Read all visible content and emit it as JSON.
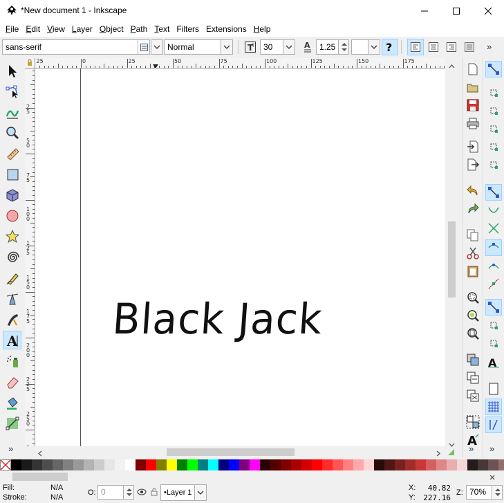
{
  "window": {
    "title": "*New document 1 - Inkscape"
  },
  "menu": [
    {
      "label": "File",
      "u": "F",
      "rest": "ile"
    },
    {
      "label": "Edit",
      "u": "E",
      "rest": "dit"
    },
    {
      "label": "View",
      "u": "V",
      "rest": "iew"
    },
    {
      "label": "Layer",
      "u": "L",
      "rest": "ayer"
    },
    {
      "label": "Object",
      "u": "O",
      "rest": "bject"
    },
    {
      "label": "Path",
      "u": "P",
      "rest": "ath"
    },
    {
      "label": "Text",
      "u": "T",
      "rest": "ext"
    },
    {
      "label": "Filters",
      "u": "",
      "rest": "Filters"
    },
    {
      "label": "Extensions",
      "u": "",
      "rest": "Extensions"
    },
    {
      "label": "Help",
      "u": "H",
      "rest": "elp"
    }
  ],
  "text_toolbar": {
    "font_family": "sans-serif",
    "font_style": "Normal",
    "font_size": "30",
    "line_spacing": "1.25",
    "overflow_label": "»"
  },
  "ruler_h": [
    "25",
    "0",
    "25",
    "50",
    "75",
    "100",
    "125",
    "150",
    "175"
  ],
  "ruler_v": [
    "2\n5",
    "5\n0",
    "7\n5",
    "1\n0\n0",
    "1\n2\n5",
    "1\n5\n0",
    "1\n7\n5",
    "2\n0\n0",
    "2\n2\n5",
    "2\n5\n0",
    "2\n7\n5"
  ],
  "canvas": {
    "text": "Black Jack"
  },
  "toolbox_overflow": "»",
  "commands_overflow": "»",
  "snap_overflow": "»",
  "palette": {
    "colors": [
      "#000000",
      "#1a1a1a",
      "#333333",
      "#4d4d4d",
      "#666666",
      "#808080",
      "#999999",
      "#b3b3b3",
      "#cccccc",
      "#e6e6e6",
      "#f2f2f2",
      "#ffffff",
      "#800000",
      "#ff0000",
      "#808000",
      "#ffff00",
      "#008000",
      "#00ff00",
      "#008080",
      "#00ffff",
      "#000080",
      "#0000ff",
      "#800080",
      "#ff00ff",
      "#2b0000",
      "#550000",
      "#800000",
      "#aa0000",
      "#d40000",
      "#ff0000",
      "#ff2a2a",
      "#ff5555",
      "#ff8080",
      "#ffaaaa",
      "#ffd5d5",
      "#280b0b",
      "#501616",
      "#782121",
      "#a02c2c",
      "#c83737",
      "#d35f5f",
      "#de8787",
      "#e9afaf",
      "#f4d7d7",
      "#241c1c",
      "#483737",
      "#6c5353",
      "#916f6f"
    ]
  },
  "status": {
    "fill_label": "Fill:",
    "fill_value": "N/A",
    "stroke_label": "Stroke:",
    "stroke_value": "N/A",
    "opacity_label": "O:",
    "opacity_value": "0",
    "layer_name": "•Layer 1",
    "x_label": "X:",
    "x_value": "40.82",
    "y_label": "Y:",
    "y_value": "227.16",
    "zoom_label": "Z:",
    "zoom_value": "70%"
  },
  "icons": {
    "toolbox": [
      "selector-icon",
      "node-editor-icon",
      "tweak-icon",
      "zoom-icon",
      "measure-icon",
      "rectangle-icon",
      "box3d-icon",
      "ellipse-icon",
      "star-icon",
      "spiral-icon",
      "pencil-icon",
      "pen-icon",
      "calligraphy-icon",
      "text-icon",
      "spray-icon",
      "eraser-icon",
      "paint-bucket-icon",
      "gradient-icon"
    ],
    "commands": [
      "new-document-icon",
      "open-icon",
      "save-icon",
      "print-icon",
      "import-icon",
      "export-icon",
      "undo-icon",
      "redo-icon",
      "copy-icon",
      "cut-icon",
      "paste-icon",
      "zoom-selection-icon",
      "zoom-drawing-icon",
      "zoom-page-icon",
      "duplicate-icon",
      "clone-icon",
      "unlink-clone-icon",
      "group-icon",
      "ungroup-icon"
    ]
  }
}
